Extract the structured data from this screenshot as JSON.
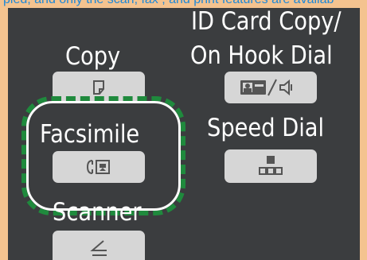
{
  "top_strip": {
    "text": "pied, and only the scan, fax , and print features are availab"
  },
  "buttons": {
    "copy": {
      "label": "Copy",
      "icon": "copy-icon"
    },
    "id_card_copy": {
      "label_line1": "ID Card Copy/",
      "label_line2": "On Hook Dial",
      "icon": "id-card-on-hook-icon"
    },
    "facsimile": {
      "label": "Facsimile",
      "icon": "facsimile-icon",
      "highlighted": true
    },
    "speed_dial": {
      "label": "Speed Dial",
      "icon": "speed-dial-icon"
    },
    "scanner": {
      "label": "Scanner",
      "icon": "scanner-icon"
    }
  },
  "colors": {
    "background": "#f4c38f",
    "panel": "#3b3d3f",
    "button": "#d6d6d6",
    "icon": "#555555",
    "highlight": "#1f8a3d",
    "text_link": "#1e88d8"
  }
}
